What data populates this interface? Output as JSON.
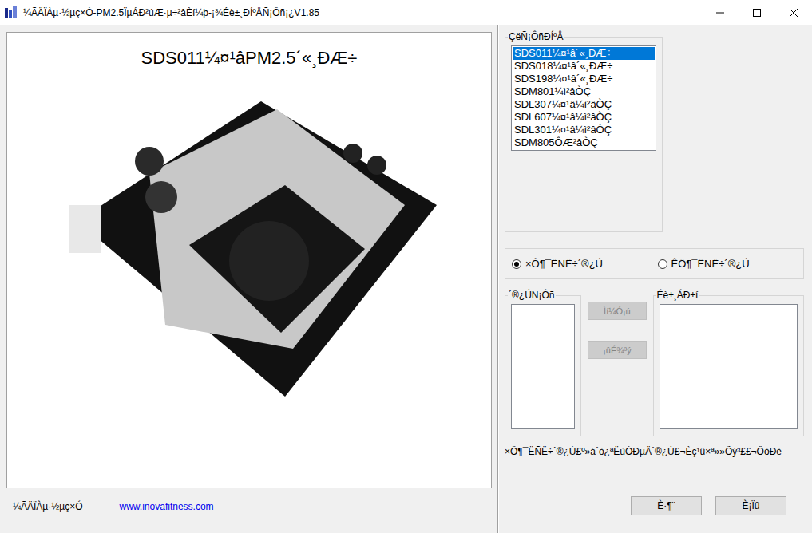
{
  "window": {
    "title": "¼ÃÄÏÀµ·½µç×Ó-PM2.5ÏµÁÐ²úÆ·µ÷²âÈí¼þ-¡¾Éè±¸ÐÍºÅÑ¡Ôñ¡¿V1.85"
  },
  "preview": {
    "heading": "SDS011¼¤¹âPM2.5´«¸ÐÆ÷"
  },
  "model_group": {
    "label": "ÇëÑ¡ÔñÐÍºÅ",
    "items": [
      {
        "label": "SDS011¼¤¹â´«¸ÐÆ÷",
        "selected": true
      },
      {
        "label": "SDS018¼¤¹â´«¸ÐÆ÷",
        "selected": false
      },
      {
        "label": "SDS198¼¤¹â´«¸ÐÆ÷",
        "selected": false
      },
      {
        "label": "SDM801¼ì²âÒÇ",
        "selected": false
      },
      {
        "label": "SDL307¼¤¹â¼ì²âÒÇ",
        "selected": false
      },
      {
        "label": "SDL607¼¤¹â¼ì²âÒÇ",
        "selected": false
      },
      {
        "label": "SDL301¼¤¹â¼ì²âÒÇ",
        "selected": false
      },
      {
        "label": "SDM805ÔÆ²âÒÇ",
        "selected": false
      }
    ]
  },
  "search_modes": [
    {
      "label": "×Ô¶¯ËÑË÷´®¿Ú",
      "selected": true
    },
    {
      "label": "ÊÖ¶¯ËÑË÷´®¿Ú",
      "selected": false
    }
  ],
  "port_group": {
    "label": "´®¿ÚÑ¡Ôñ",
    "items": []
  },
  "transfer_buttons": [
    {
      "label": "Ìí¼Ó¡ú",
      "disabled": true
    },
    {
      "label": "¡ûÉ¾³ý",
      "disabled": true
    }
  ],
  "device_group": {
    "label": "Éè±¸ÁÐ±í",
    "items": []
  },
  "hint": "×Ô¶¯ËÑË÷´®¿Ú£º»á´ò¿ªËùÓÐµÄ´®¿Ú£¬Èç¹û×ª»»Õý³££¬ÔòÐè",
  "footer": {
    "company": "¼ÃÄÏÀµ·½µç×Ó",
    "link": "www.inovafitness.com"
  },
  "buttons": [
    {
      "label": "È·¶¨"
    },
    {
      "label": "È¡Ïû"
    }
  ]
}
